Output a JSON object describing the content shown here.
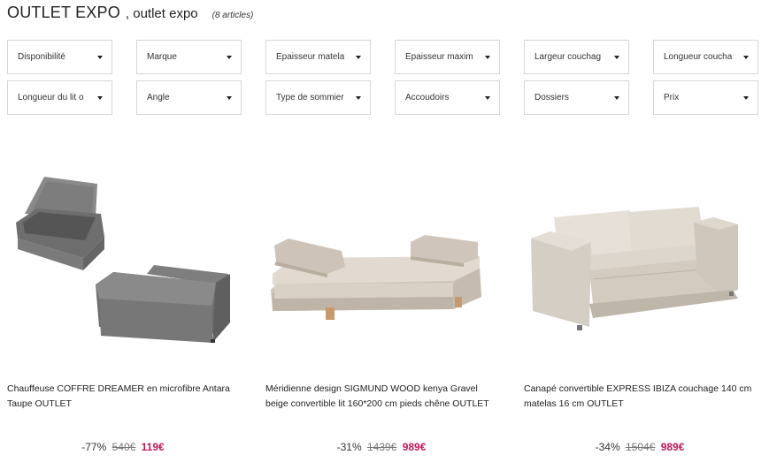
{
  "header": {
    "title": "OUTLET EXPO",
    "subtitle": ", outlet expo",
    "count": "(8 articles)"
  },
  "filters": [
    {
      "label": "Disponibilité"
    },
    {
      "label": "Marque"
    },
    {
      "label": "Épaisseur matela"
    },
    {
      "label": "Épaisseur maxim"
    },
    {
      "label": "Largeur couchag"
    },
    {
      "label": "Longueur coucha"
    },
    {
      "label": "Longueur du lit o"
    },
    {
      "label": "Angle"
    },
    {
      "label": "Type de sommier"
    },
    {
      "label": "Accoudoirs"
    },
    {
      "label": "Dossiers"
    },
    {
      "label": "Prix"
    }
  ],
  "products": [
    {
      "name": "Chauffeuse COFFRE DREAMER en microfibre Antara Taupe OUTLET",
      "discount": "-77%",
      "old_price": "540€",
      "new_price": "119€",
      "image_icon": "grey-storage-chair-image"
    },
    {
      "name": "Méridienne design SIGMUND WOOD kenya Gravel beige convertible lit 160*200 cm pieds chêne OUTLET",
      "discount": "-31%",
      "old_price": "1439€",
      "new_price": "989€",
      "image_icon": "beige-daybed-image"
    },
    {
      "name": "Canapé convertible EXPRESS IBIZA couchage 140 cm matelas 16 cm OUTLET",
      "discount": "-34%",
      "old_price": "1504€",
      "new_price": "989€",
      "image_icon": "beige-sofa-image"
    }
  ],
  "colors": {
    "sale_price": "#c2185b",
    "border": "#d6d6d6"
  }
}
